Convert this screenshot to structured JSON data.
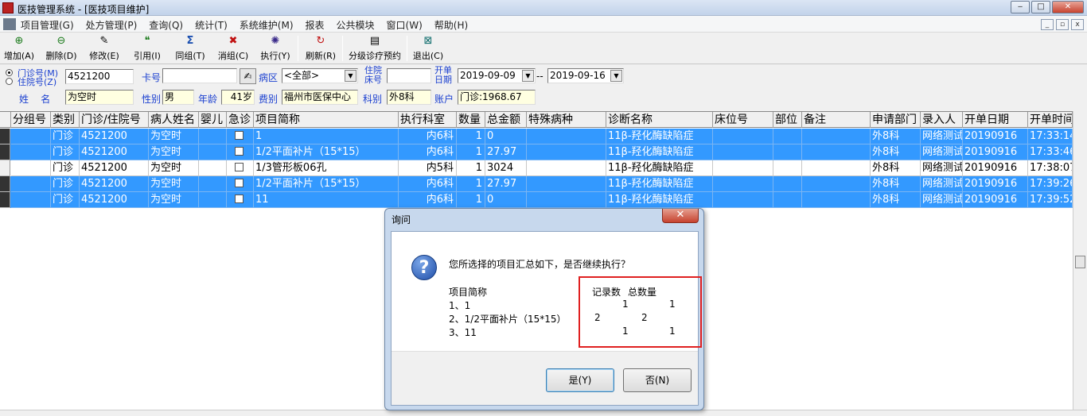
{
  "window": {
    "title": "医技管理系统 - [医技项目维护]",
    "btn_min": "‒",
    "btn_max": "□",
    "btn_close": "✕"
  },
  "menu": {
    "items": [
      "项目管理(G)",
      "处方管理(P)",
      "查询(Q)",
      "统计(T)",
      "系统维护(M)",
      "报表",
      "公共模块",
      "窗口(W)",
      "帮助(H)"
    ]
  },
  "toolbar": {
    "items": [
      {
        "label": "增加(A)",
        "icon": "add-icon"
      },
      {
        "label": "删除(D)",
        "icon": "delete-icon"
      },
      {
        "label": "修改(E)",
        "icon": "edit-icon"
      },
      {
        "label": "引用(I)",
        "icon": "quote-icon"
      },
      {
        "label": "同组(T)",
        "icon": "sigma-icon"
      },
      {
        "label": "消组(C)",
        "icon": "ungroup-icon"
      },
      {
        "label": "执行(Y)",
        "icon": "execute-icon"
      },
      {
        "label": "刷新(R)",
        "icon": "refresh-icon"
      },
      {
        "label": "分级诊疗预约",
        "icon": "referral-icon"
      },
      {
        "label": "退出(C)",
        "icon": "exit-icon"
      }
    ]
  },
  "form": {
    "radio_outpatient": "门诊号(M)",
    "radio_inpatient": "住院号(Z)",
    "patient_no": "4521200",
    "card_label": "卡号",
    "card_no": "",
    "ward_label": "病区",
    "ward_value": "<全部>",
    "bed_label_1": "住院",
    "bed_label_2": "床号",
    "bed_no": "",
    "open_date_label_1": "开单",
    "open_date_label_2": "日期",
    "date_from": "2019-09-09",
    "date_sep": "--",
    "date_to": "2019-09-16",
    "name_label": "姓    名",
    "name_value": "为空时",
    "gender_label": "性别",
    "gender_value": "男",
    "age_label": "年龄",
    "age_value": "41岁",
    "fee_label": "费别",
    "fee_value": "福州市医保中心",
    "dept_label": "科别",
    "dept_value": "外8科",
    "account_label": "账户",
    "account_value": "门诊:1968.67"
  },
  "table": {
    "columns": [
      "分组号",
      "类别",
      "门诊/住院号",
      "病人姓名",
      "婴儿",
      "急诊",
      "项目简称",
      "执行科室",
      "数量",
      "总金额",
      "特殊病种",
      "诊断名称",
      "床位号",
      "部位",
      "备注",
      "申请部门",
      "录入人",
      "开单日期",
      "开单时间"
    ],
    "rows": [
      {
        "selected": true,
        "cells": [
          "",
          "门诊",
          "4521200",
          "为空时",
          "",
          "",
          "1",
          "内6科",
          "1",
          "0",
          "",
          "11β-羟化酶缺陷症",
          "",
          "",
          "",
          "外8科",
          "网络测试",
          "20190916",
          "17:33:14"
        ]
      },
      {
        "selected": true,
        "cells": [
          "",
          "门诊",
          "4521200",
          "为空时",
          "",
          "",
          "1/2平面补片（15*15）",
          "内6科",
          "1",
          "27.97",
          "",
          "11β-羟化酶缺陷症",
          "",
          "",
          "",
          "外8科",
          "网络测试",
          "20190916",
          "17:33:46"
        ]
      },
      {
        "selected": false,
        "cells": [
          "",
          "门诊",
          "4521200",
          "为空时",
          "",
          "",
          "1/3管形板06孔",
          "内5科",
          "1",
          "3024",
          "",
          "11β-羟化酶缺陷症",
          "",
          "",
          "",
          "外8科",
          "网络测试",
          "20190916",
          "17:38:07"
        ]
      },
      {
        "selected": true,
        "cells": [
          "",
          "门诊",
          "4521200",
          "为空时",
          "",
          "",
          "1/2平面补片（15*15）",
          "内6科",
          "1",
          "27.97",
          "",
          "11β-羟化酶缺陷症",
          "",
          "",
          "",
          "外8科",
          "网络测试",
          "20190916",
          "17:39:26"
        ]
      },
      {
        "selected": true,
        "cells": [
          "",
          "门诊",
          "4521200",
          "为空时",
          "",
          "",
          "11",
          "内6科",
          "1",
          "0",
          "",
          "11β-羟化酶缺陷症",
          "",
          "",
          "",
          "外8科",
          "网络测试",
          "20190916",
          "17:39:52"
        ]
      }
    ]
  },
  "dialog": {
    "title": "询问",
    "close": "✕",
    "icon": "question-icon",
    "message": "您所选择的项目汇总如下，是否继续执行？",
    "list_header": "项目简称",
    "list_items": [
      "1、1",
      "2、1/2平面补片（15*15）",
      "3、11"
    ],
    "count_header": "记录数",
    "total_header": "总数量",
    "summary_rows": [
      {
        "count": "1",
        "total": "1"
      },
      {
        "count": "2",
        "total": "2"
      },
      {
        "count": "1",
        "total": "1"
      }
    ],
    "yes_button": "是(Y)",
    "no_button": "否(N)"
  }
}
